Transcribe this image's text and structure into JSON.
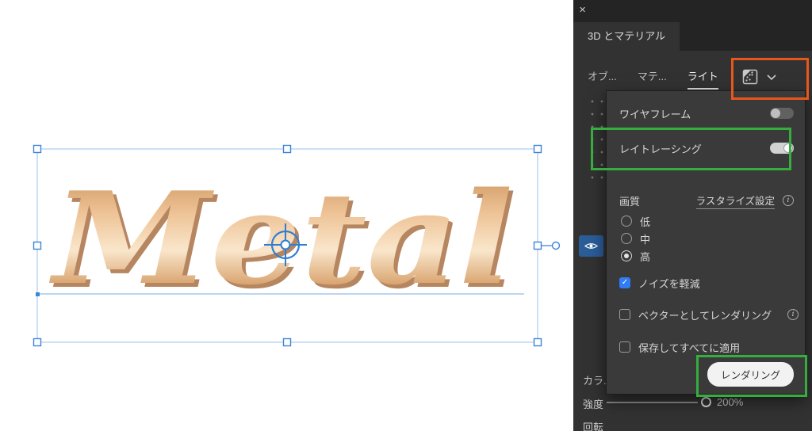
{
  "window": {
    "close_glyph": "✕"
  },
  "panel": {
    "title": "3D とマテリアル",
    "tabs": [
      {
        "label": "オブ..."
      },
      {
        "label": "マテ..."
      },
      {
        "label": "ライト"
      }
    ],
    "dropdown": {
      "wireframe_label": "ワイヤフレーム",
      "wireframe_on": false,
      "raytracing_label": "レイトレーシング",
      "raytracing_on": true,
      "quality_label": "画質",
      "rasterize_link": "ラスタライズ設定",
      "quality_options": [
        {
          "label": "低",
          "selected": false
        },
        {
          "label": "中",
          "selected": false
        },
        {
          "label": "高",
          "selected": true
        }
      ],
      "noise_checkbox_label": "ノイズを軽減",
      "noise_checked": true,
      "vector_checkbox_label": "ベクターとしてレンダリング",
      "vector_checked": false,
      "save_checkbox_label": "保存してすべてに適用",
      "save_checked": false,
      "render_button_label": "レンダリング"
    },
    "background_content": {
      "color_label": "カラ...",
      "intensity_label": "強度",
      "intensity_value": "200%",
      "rotation_label": "回転"
    }
  },
  "canvas": {
    "artwork_text": "Metal"
  },
  "colors": {
    "annotation_orange": "#e7571c",
    "annotation_green": "#35ad3f",
    "selection_blue": "#3c86d8",
    "checkbox_blue": "#2f7cf6"
  }
}
